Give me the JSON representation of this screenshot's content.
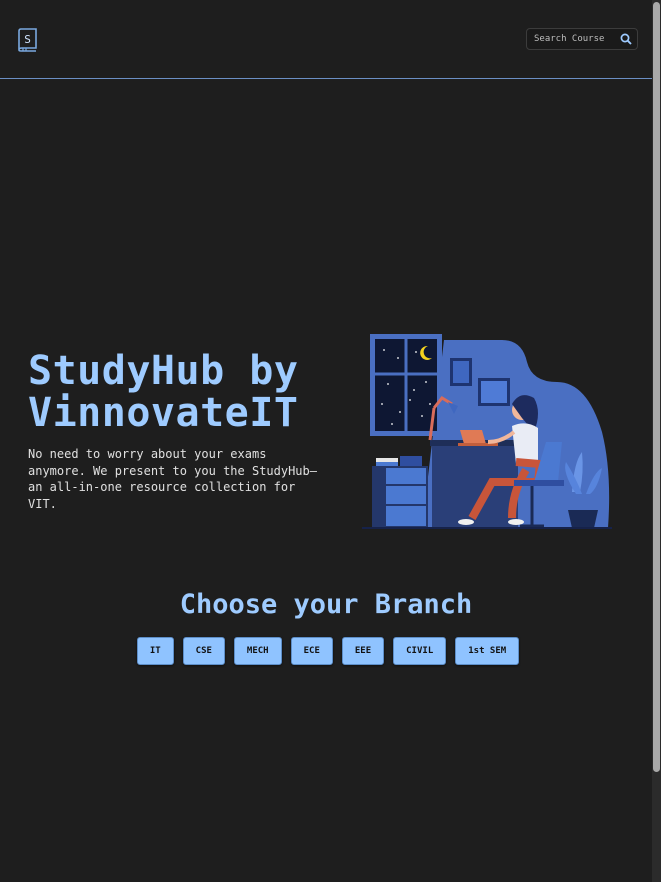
{
  "header": {
    "logo_icon": "book-s-icon",
    "search": {
      "placeholder": "Search Course",
      "icon": "search-icon"
    }
  },
  "hero": {
    "title_line1": "StudyHub by",
    "title_line2": "VinnovateIT",
    "description": "No need to worry about your exams anymore. We present to you the StudyHub—an all-in-one resource collection for VIT.",
    "illustration": "woman-studying-at-desk-night-illustration"
  },
  "branches": {
    "title": "Choose your Branch",
    "items": [
      "IT",
      "CSE",
      "MECH",
      "ECE",
      "EEE",
      "CIVIL",
      "1st SEM"
    ]
  },
  "colors": {
    "background": "#1e1e1e",
    "accent": "#9ecbff",
    "button": "#8fc3ff",
    "divider": "#6b8fc4"
  }
}
